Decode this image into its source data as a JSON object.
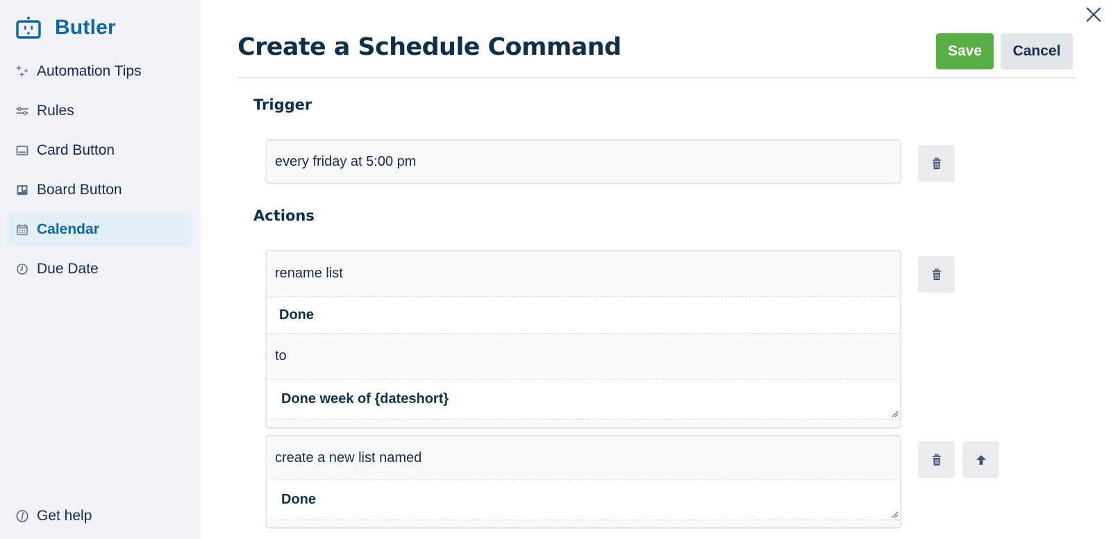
{
  "sidebar": {
    "brand": {
      "name": "Butler",
      "icon": "robot-icon",
      "color": "#0b67a6"
    },
    "items": [
      {
        "label": "Automation Tips",
        "icon": "sparkles-icon",
        "active": false
      },
      {
        "label": "Rules",
        "icon": "sliders-icon",
        "active": false
      },
      {
        "label": "Card Button",
        "icon": "card-button-icon",
        "active": false
      },
      {
        "label": "Board Button",
        "icon": "board-button-icon",
        "active": false
      },
      {
        "label": "Calendar",
        "icon": "calendar-icon",
        "active": true
      },
      {
        "label": "Due Date",
        "icon": "clock-icon",
        "active": false
      }
    ],
    "help": {
      "label": "Get help",
      "icon": "info-icon"
    }
  },
  "header": {
    "title": "Create a Schedule Command",
    "save_label": "Save",
    "cancel_label": "Cancel",
    "close_icon": "close-icon",
    "save_color": "#5aac44"
  },
  "trigger": {
    "label": "Trigger",
    "value": "every friday at 5:00 pm"
  },
  "actions": {
    "label": "Actions",
    "items": [
      {
        "parts": [
          {
            "type": "text",
            "value": "rename list"
          },
          {
            "type": "input",
            "value": "Done"
          },
          {
            "type": "text",
            "value": "to"
          },
          {
            "type": "input",
            "value": "Done week of {dateshort}"
          }
        ]
      },
      {
        "parts": [
          {
            "type": "text",
            "value": "create a new list named"
          },
          {
            "type": "input",
            "value": "Done"
          }
        ]
      }
    ]
  }
}
